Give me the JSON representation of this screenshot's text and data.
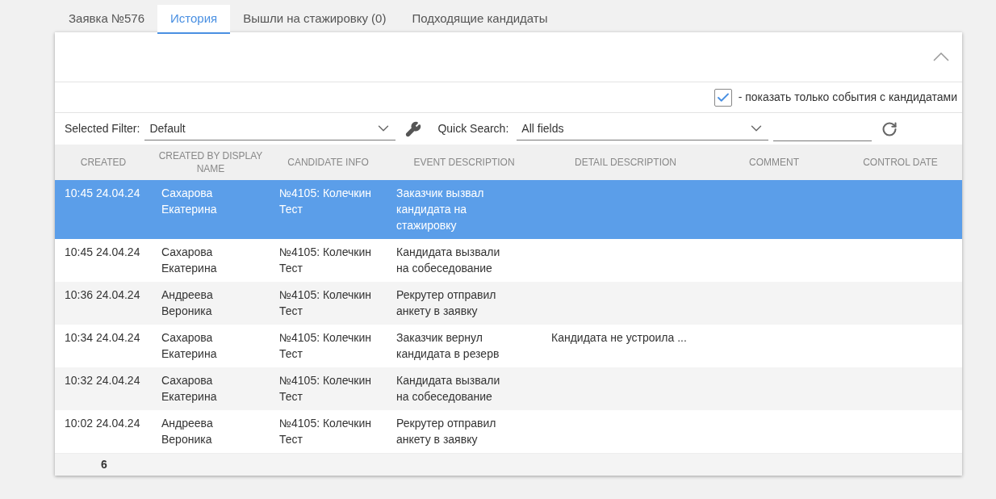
{
  "tabs": [
    {
      "label": "Заявка №576",
      "selected": false
    },
    {
      "label": "История",
      "selected": true
    },
    {
      "label": "Вышли на стажировку (0)",
      "selected": false
    },
    {
      "label": "Подходящие кандидаты",
      "selected": false
    }
  ],
  "panel": {
    "expanded": true
  },
  "candidates_only": {
    "checked": true,
    "label": "- показать только события с кандидатами"
  },
  "filter": {
    "label": "Selected Filter:",
    "value": "Default"
  },
  "quick_search": {
    "label": "Quick Search:",
    "value": "All fields"
  },
  "table": {
    "columns": [
      "CREATED",
      "CREATED BY DISPLAY NAME",
      "CANDIDATE INFO",
      "EVENT DESCRIPTION",
      "DETAIL DESCRIPTION",
      "COMMENT",
      "CONTROL DATE"
    ],
    "rows": [
      {
        "selected": true,
        "cells": [
          "10:45 24.04.24",
          "Сахарова Екатерина",
          "№4105: Колечкин Тест",
          "Заказчик вызвал кандидата на стажировку",
          "",
          "",
          ""
        ]
      },
      {
        "selected": false,
        "cells": [
          "10:45 24.04.24",
          "Сахарова Екатерина",
          "№4105: Колечкин Тест",
          "Кандидата вызвали на собеседование",
          "",
          "",
          ""
        ]
      },
      {
        "selected": false,
        "cells": [
          "10:36 24.04.24",
          "Андреева Вероника",
          "№4105: Колечкин Тест",
          "Рекрутер отправил анкету в заявку",
          "",
          "",
          ""
        ]
      },
      {
        "selected": false,
        "cells": [
          "10:34 24.04.24",
          "Сахарова Екатерина",
          "№4105: Колечкин Тест",
          "Заказчик вернул кандидата в резерв",
          "Кандидата не устроила ...",
          "",
          ""
        ]
      },
      {
        "selected": false,
        "cells": [
          "10:32 24.04.24",
          "Сахарова Екатерина",
          "№4105: Колечкин Тест",
          "Кандидата вызвали на собеседование",
          "",
          "",
          ""
        ]
      },
      {
        "selected": false,
        "cells": [
          "10:02 24.04.24",
          "Андреева Вероника",
          "№4105: Колечкин Тест",
          "Рекрутер отправил анкету в заявку",
          "",
          "",
          ""
        ]
      }
    ],
    "footer_count": "6"
  }
}
